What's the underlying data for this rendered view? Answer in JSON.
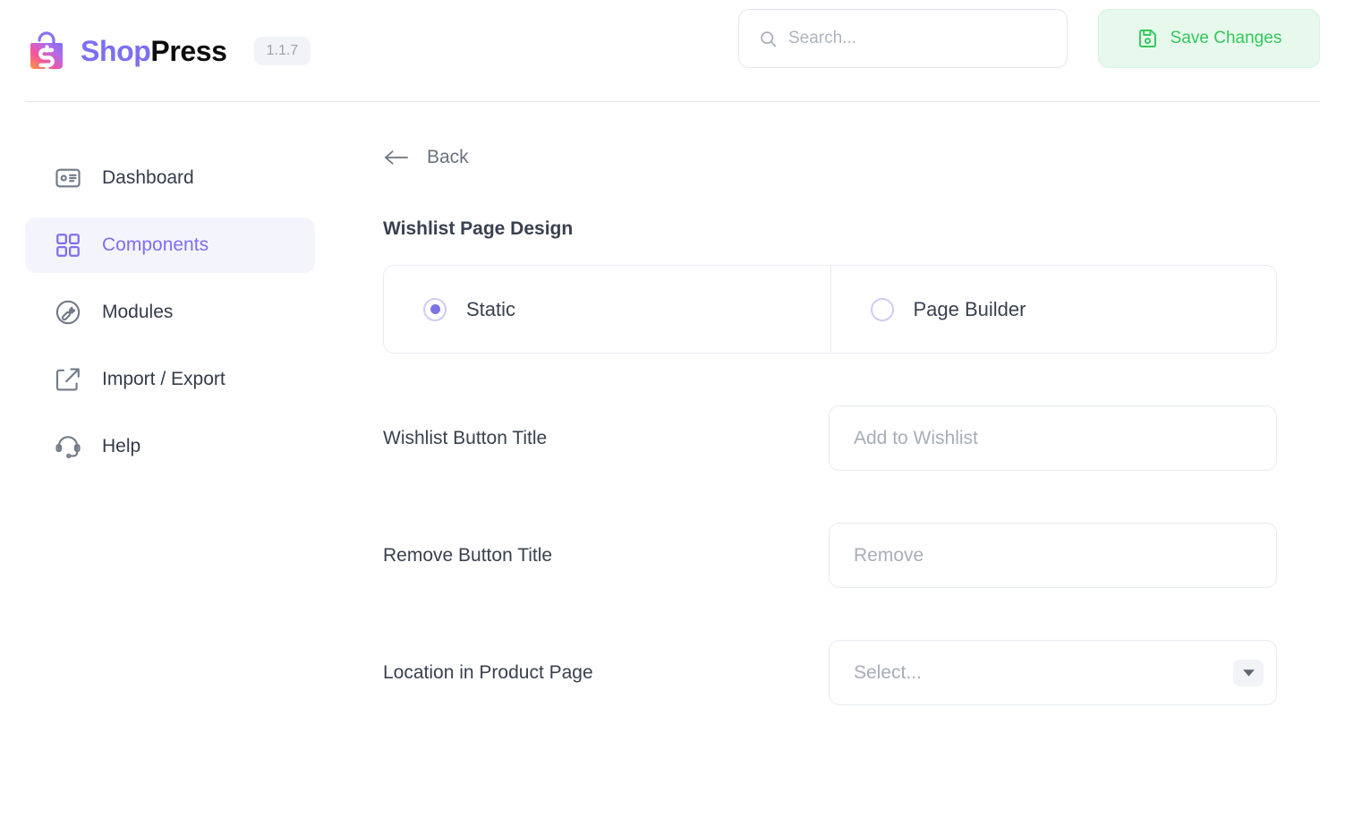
{
  "header": {
    "brand_part1": "Shop",
    "brand_part2": "Press",
    "version": "1.1.7",
    "search": {
      "value": "",
      "placeholder": "Search...",
      "icon": "search-icon"
    },
    "save_button": {
      "label": "Save Changes",
      "icon": "save-floppy-icon",
      "text_color": "#35c65c",
      "bg_color": "#e6f9ec"
    }
  },
  "sidebar": {
    "items": [
      {
        "label": "Dashboard",
        "icon": "id-card-icon",
        "active": false
      },
      {
        "label": "Components",
        "icon": "grid-squares-icon",
        "active": true
      },
      {
        "label": "Modules",
        "icon": "wrench-circle-icon",
        "active": false
      },
      {
        "label": "Import / Export",
        "icon": "share-box-icon",
        "active": false
      },
      {
        "label": "Help",
        "icon": "headset-icon",
        "active": false
      }
    ],
    "active_color": "#7c6ff0",
    "active_bg": "#f4f4fd"
  },
  "main": {
    "back_label": "Back",
    "back_icon": "arrow-left-icon",
    "section_title": "Wishlist Page Design",
    "design_options": [
      {
        "label": "Static",
        "selected": true
      },
      {
        "label": "Page Builder",
        "selected": false
      }
    ],
    "fields": [
      {
        "label": "Wishlist Button Title",
        "type": "text",
        "value": "",
        "placeholder": "Add to Wishlist"
      },
      {
        "label": "Remove Button Title",
        "type": "text",
        "value": "",
        "placeholder": "Remove"
      },
      {
        "label": "Location in Product Page",
        "type": "select",
        "value": "Select...",
        "placeholder": "Select..."
      }
    ]
  }
}
